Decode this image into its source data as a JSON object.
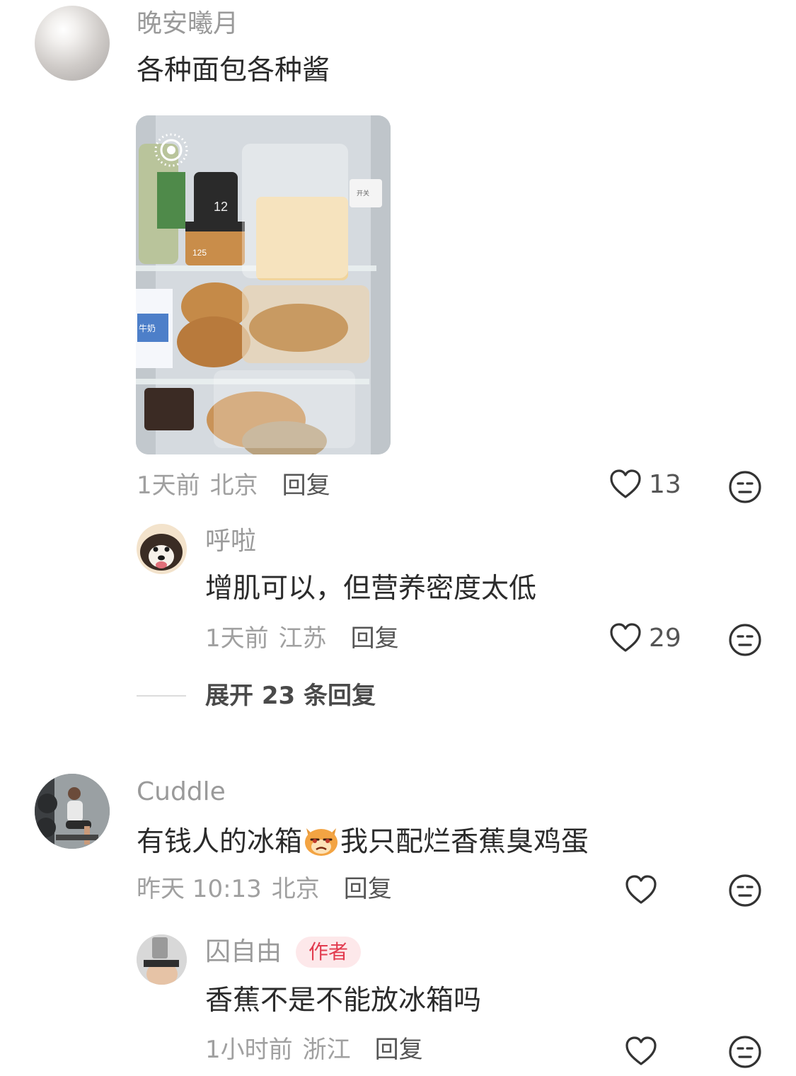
{
  "comments": [
    {
      "user": "晚安曦月",
      "text": "各种面包各种酱",
      "time": "1天前",
      "location": "北京",
      "reply_label": "回复",
      "likes": "13",
      "has_image": true,
      "image_labels": {
        "jar": "12",
        "label": "125",
        "switch": "开关",
        "milk": "牛奶"
      },
      "replies": [
        {
          "user": "呼啦",
          "text": "增肌可以，但营养密度太低",
          "time": "1天前",
          "location": "江苏",
          "reply_label": "回复",
          "likes": "29"
        }
      ],
      "expand": {
        "prefix": "展开",
        "count": "23",
        "suffix": "条回复"
      }
    },
    {
      "user": "Cuddle",
      "text_before_emoji": "有钱人的冰箱",
      "emoji": "dog-emoji",
      "text_after_emoji": "我只配烂香蕉臭鸡蛋",
      "time": "昨天 10:13",
      "location": "北京",
      "reply_label": "回复",
      "likes": "",
      "replies": [
        {
          "user": "囚自由",
          "badge": "作者",
          "text": "香蕉不是不能放冰箱吗",
          "time": "1小时前",
          "location": "浙江",
          "reply_label": "回复",
          "likes": ""
        }
      ]
    }
  ],
  "icons": {
    "like": "heart-outline-icon",
    "dislike": "meh-face-icon"
  },
  "colors": {
    "accent": "#e23b4f",
    "badge_bg": "#fde8ea",
    "meta": "#a0a0a0"
  }
}
